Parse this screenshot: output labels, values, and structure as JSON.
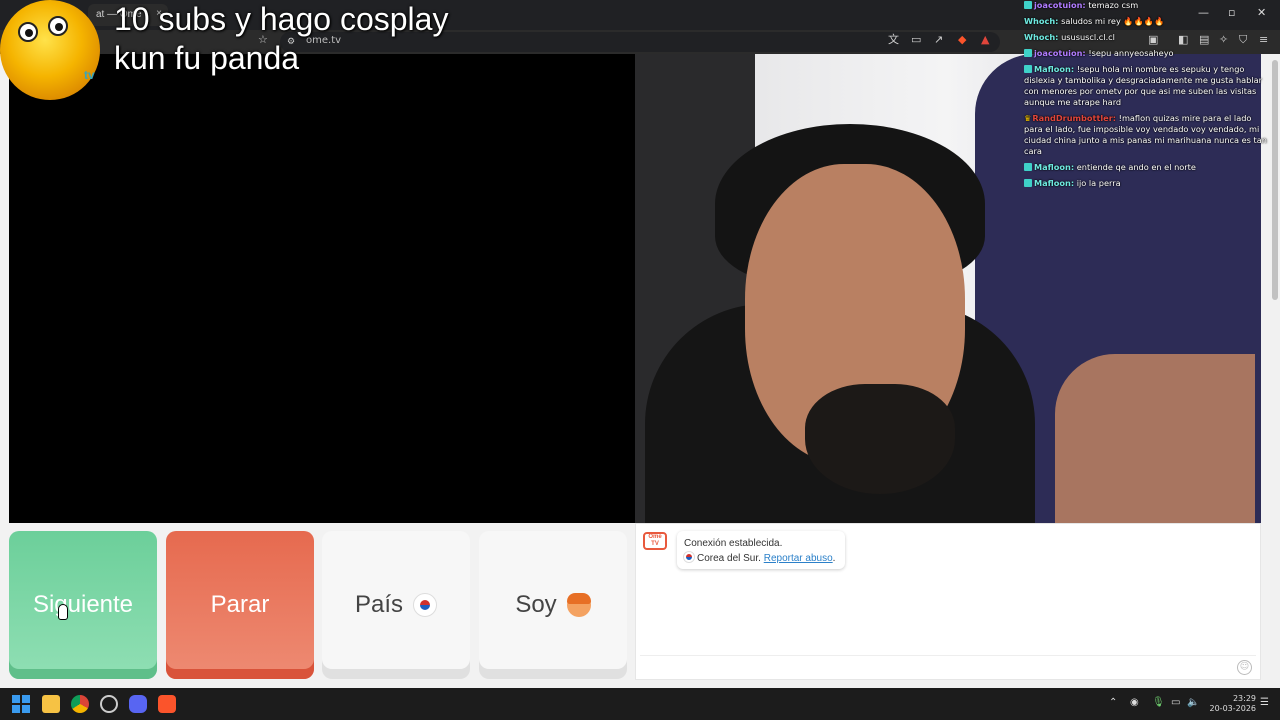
{
  "browser": {
    "tab_title": "at — Ome",
    "tab_close": "×",
    "url": "ome.tv",
    "window_controls": {
      "minimize": "—",
      "maximize": "▫",
      "close": "✕"
    }
  },
  "overlay": {
    "title_line1": "10 subs y hago cosplay",
    "title_line2": "kun fu panda",
    "logo_text": "tv"
  },
  "stream_chat": [
    {
      "user": "joacotuion:",
      "message": "temazo csm",
      "user_color": "#b07cff",
      "badge": true
    },
    {
      "user": "Whoch:",
      "message": "saludos mi rey 🔥🔥🔥🔥",
      "user_color": "#6ee9e0",
      "badge": false
    },
    {
      "user": "Whoch:",
      "message": "usususcl.cl.cl",
      "user_color": "#6ee9e0",
      "badge": false
    },
    {
      "user": "joacotuion:",
      "message": "!sepu annyeosaheyo",
      "user_color": "#b07cff",
      "badge": true
    },
    {
      "user": "Mafloon:",
      "message": "!sepu hola mi nombre es sepuku y tengo dislexia y tambolika y desgraciadamente me gusta hablar con menores por ometv por que asi me suben las visitas aunque me atrape hard",
      "user_color": "#6ee9e0",
      "badge": true
    },
    {
      "user": "RandDrumbottler:",
      "message": "!maflon quizas mire para el lado para el lado, fue imposible voy vendado voy vendado, mi ciudad china junto a mis panas mi marihuana nunca es tan cara",
      "user_color": "#e0453b",
      "badge": false,
      "crown": true
    },
    {
      "user": "Mafloon:",
      "message": "entiende qe ando en el norte",
      "user_color": "#6ee9e0",
      "badge": true
    },
    {
      "user": "Mafloon:",
      "message": "ijo la perra",
      "user_color": "#6ee9e0",
      "badge": true
    }
  ],
  "controls": {
    "next_label": "Siguiente",
    "stop_label": "Parar",
    "country_label": "País",
    "gender_label": "Soy"
  },
  "chat": {
    "logo_text": "Ome TV",
    "status": "Conexión establecida.",
    "country": "Corea del Sur.",
    "report_link": "Reportar abuso",
    "report_suffix": ".",
    "emoji_icon": "☺"
  },
  "taskbar": {
    "time": "23:29",
    "date": "20-03-2026"
  },
  "colors": {
    "next_button": "#6ccf9a",
    "stop_button": "#e66a4f",
    "report_link": "#2b80c9"
  }
}
